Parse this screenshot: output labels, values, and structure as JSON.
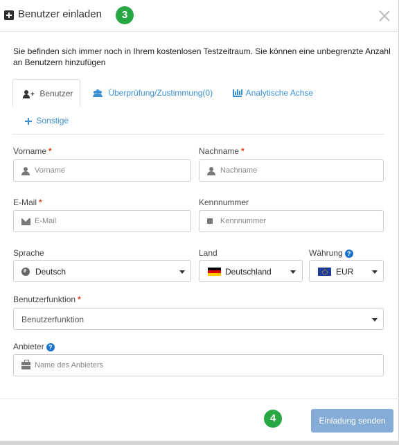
{
  "header": {
    "title": "Benutzer einladen",
    "step_badge": "3"
  },
  "info": {
    "text": "Sie befinden sich immer noch in Ihrem kostenlosen Testzeitraum. Sie können eine unbegrenzte Anzahl an Benutzern hinzufügen"
  },
  "tabs": [
    {
      "label": "Benutzer",
      "active": true
    },
    {
      "label": "Überprüfung/Zustimmung(0)",
      "active": false
    },
    {
      "label": "Analytische Achse",
      "active": false
    },
    {
      "label": "Sonstige",
      "active": false
    }
  ],
  "form": {
    "required_marker": "*",
    "first_name": {
      "label": "Vorname",
      "placeholder": "Vorname"
    },
    "last_name": {
      "label": "Nachname",
      "placeholder": "Nachname"
    },
    "email": {
      "label": "E-Mail",
      "placeholder": "E-Mail"
    },
    "id_number": {
      "label": "Kennnummer",
      "placeholder": "Kennnummer"
    },
    "language": {
      "label": "Sprache",
      "value": "Deutsch"
    },
    "country": {
      "label": "Land",
      "value": "Deutschland"
    },
    "currency": {
      "label": "Währung",
      "value": "EUR",
      "help": "?"
    },
    "role": {
      "label": "Benutzerfunktion",
      "placeholder": "Benutzerfunktion"
    },
    "provider": {
      "label": "Anbieter",
      "placeholder": "Name des Anbieters",
      "help": "?"
    }
  },
  "footer": {
    "step_badge": "4",
    "send_label": "Einladung senden"
  },
  "colors": {
    "accent_link": "#3a8fd3",
    "step_badge": "#28a745",
    "required": "#e43d1a",
    "button": "#84acd6"
  }
}
